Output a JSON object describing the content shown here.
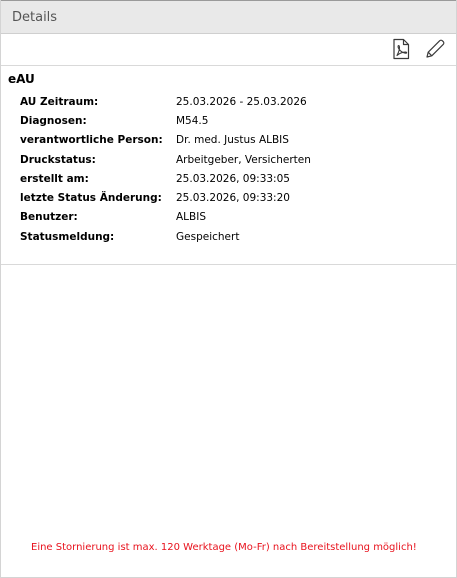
{
  "panel": {
    "title": "Details"
  },
  "toolbar": {
    "pdf_icon": "pdf-document-icon",
    "edit_icon": "pencil-edit-icon"
  },
  "section": {
    "title": "eAU",
    "rows": [
      {
        "label": "AU Zeitraum:",
        "value": "25.03.2026 - 25.03.2026"
      },
      {
        "label": "Diagnosen:",
        "value": "M54.5"
      },
      {
        "label": "verantwortliche Person:",
        "value": "Dr. med. Justus ALBIS"
      },
      {
        "label": "Druckstatus:",
        "value": "Arbeitgeber, Versicherten"
      },
      {
        "label": "erstellt am:",
        "value": "25.03.2026, 09:33:05"
      },
      {
        "label": "letzte Status Änderung:",
        "value": "25.03.2026, 09:33:20"
      },
      {
        "label": "Benutzer:",
        "value": "ALBIS"
      },
      {
        "label": "Statusmeldung:",
        "value": "Gespeichert"
      }
    ]
  },
  "notice": {
    "text": "Eine Stornierung ist max. 120 Werktage (Mo-Fr) nach Bereitstellung möglich!",
    "color": "#e8121d"
  }
}
